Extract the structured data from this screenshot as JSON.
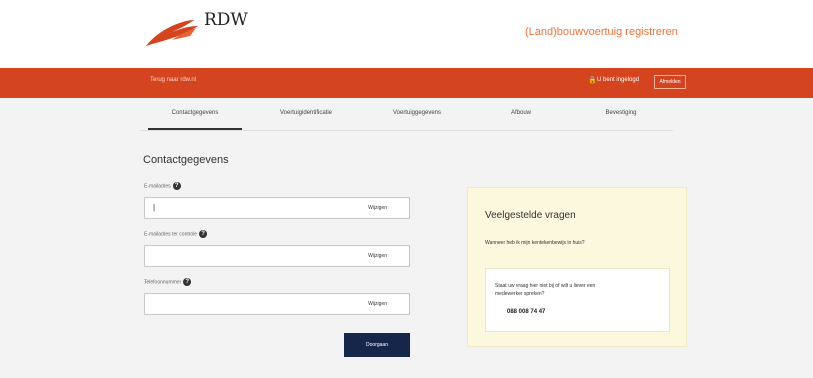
{
  "header": {
    "logo_text": "RDW",
    "site_title": "(Land)bouwvoertuig registreren"
  },
  "bar": {
    "back_link": "Terug naar rdw.nl",
    "login_status": "U bent ingelogd",
    "logout": "Afmelden"
  },
  "tabs": [
    {
      "label": "Contactgegevens",
      "active": true
    },
    {
      "label": "Voertuigidentificatie",
      "active": false
    },
    {
      "label": "Voertuiggegevens",
      "active": false
    },
    {
      "label": "Afbouw",
      "active": false
    },
    {
      "label": "Bevestiging",
      "active": false
    }
  ],
  "form": {
    "title": "Contactgegevens",
    "fields": [
      {
        "label": "E-mailadres",
        "value": "|",
        "action": "Wijzigen"
      },
      {
        "label": "E-mailadres ter controle",
        "value": "",
        "action": "Wijzigen"
      },
      {
        "label": "Telefoonnummer",
        "value": "",
        "action": "Wijzigen"
      }
    ],
    "submit": "Doorgaan"
  },
  "faq": {
    "title": "Veelgestelde vragen",
    "question": "Wanneer heb ik mijn kentekenbewijs in huis?",
    "contact_line1": "Staat uw vraag hier niet bij of wilt u liever een",
    "contact_line2": "medewerker spreken?",
    "phone": "088 008 74 47"
  },
  "icons": {
    "logo": "rdw-wing-logo",
    "lock": "lock-icon",
    "help": "question-mark-icon"
  },
  "colors": {
    "bar": "#d4441f",
    "title_accent": "#e7733a",
    "button": "#16254a",
    "faq_bg": "#fbf8de"
  }
}
